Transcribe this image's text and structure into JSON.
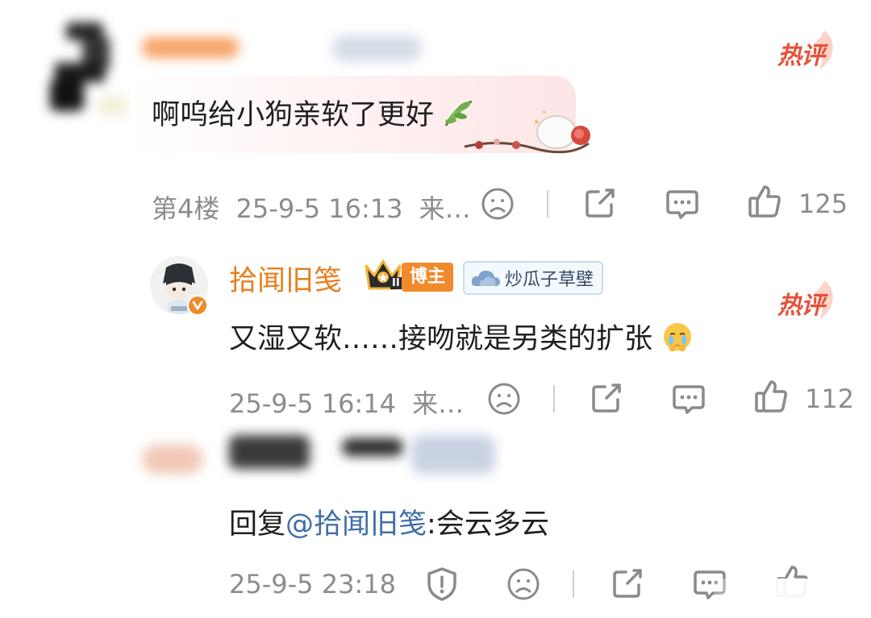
{
  "comment_1": {
    "text": "啊呜给小狗亲软了更好",
    "text_emoji": "leaf-emoji",
    "hot_badge": "热评",
    "floor": "第4楼",
    "time": "25-9-5 16:13",
    "source": "来…",
    "likes": "125"
  },
  "reply_1": {
    "username": "拾闻旧笺",
    "blogger_badge": "博主",
    "crown_level": "II",
    "fan_badge": "炒瓜子草壁",
    "text": "又湿又软……接吻就是另类的扩张",
    "text_emoji": "crying-emoji",
    "hot_badge": "热评",
    "time": "25-9-5 16:14",
    "source": "来…",
    "likes": "112"
  },
  "reply_2": {
    "prefix": "回复",
    "mention": "@拾闻旧笺",
    "text": ":会云多云",
    "time": "25-9-5 23:18"
  },
  "colors": {
    "username": "#e87e1e",
    "hot_badge": "#e8503a",
    "mention": "#3f6fa8",
    "meta_text": "#8c8c8c",
    "blogger_badge": "#f08a2a",
    "fan_badge_border": "#b8d0ea"
  }
}
